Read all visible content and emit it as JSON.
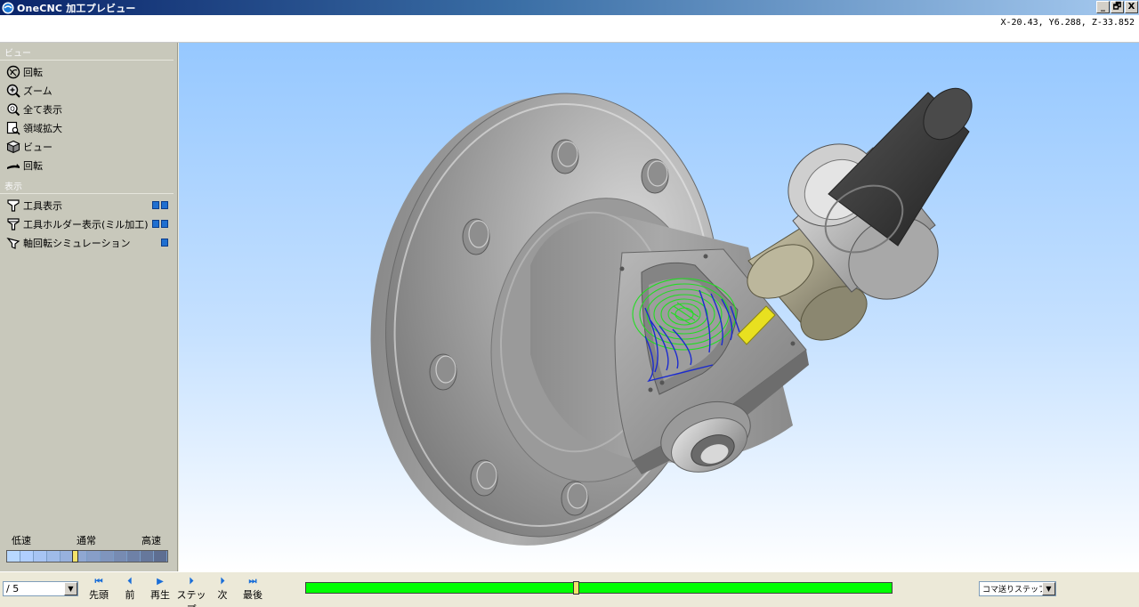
{
  "window": {
    "title": "OneCNC 加工プレビュー",
    "controls": [
      "_",
      "🗗",
      "X"
    ]
  },
  "coords": "X-20.43, Y6.288, Z-33.852",
  "sidebar": {
    "view_section": "ビュー",
    "view_items": [
      {
        "label": "回転",
        "icon": "rotate-icon"
      },
      {
        "label": "ズーム",
        "icon": "zoom-icon"
      },
      {
        "label": "全て表示",
        "icon": "zoom-all-icon"
      },
      {
        "label": "領域拡大",
        "icon": "zoom-window-icon"
      },
      {
        "label": "ビュー",
        "icon": "view-cube-icon"
      },
      {
        "label": "回転",
        "icon": "rotate-part-icon"
      }
    ],
    "display_section": "表示",
    "display_items": [
      {
        "label": "工具表示",
        "icon": "tool-icon",
        "toggles": 2
      },
      {
        "label": "工具ホルダー表示(ミル加工)",
        "icon": "tool-holder-icon",
        "toggles": 2
      },
      {
        "label": "軸回転シミュレーション",
        "icon": "axis-rotation-icon",
        "toggles": 1
      }
    ],
    "speed": {
      "slow": "低速",
      "normal": "通常",
      "fast": "高速",
      "value": 0.42
    }
  },
  "bottom": {
    "step_select": "/ 5",
    "nav": {
      "first": "先頭",
      "prev": "前",
      "play": "再生",
      "step": "ステップ",
      "next": "次",
      "last": "最後"
    },
    "progress": 0.46,
    "frame_select": "コマ送りステップ数"
  },
  "colors": {
    "toolpath_green": "#22dd22",
    "toolpath_blue": "#1a2ad0",
    "progress_fill": "#00ff00",
    "tool_yellow": "#e8e020"
  }
}
